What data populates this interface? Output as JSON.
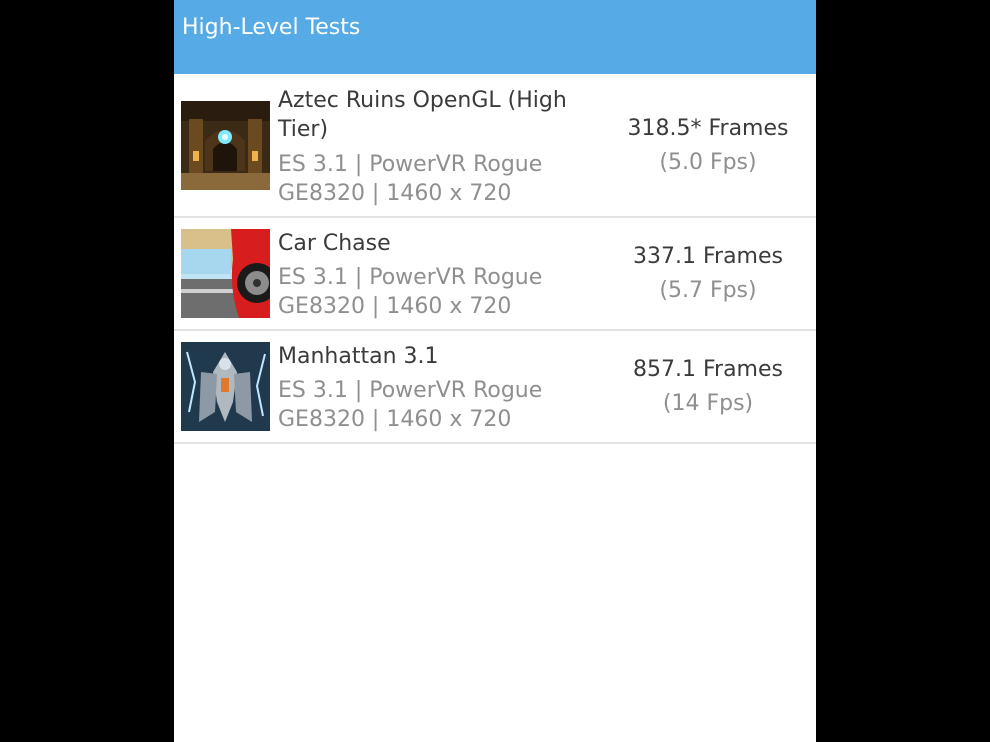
{
  "header": {
    "title": "High-Level Tests",
    "color": "#56abe6"
  },
  "tests": [
    {
      "title": "Aztec Ruins OpenGL (High Tier)",
      "api_line": "ES 3.1 | PowerVR Rogue",
      "device_line": "GE8320 | 1460 x 720",
      "frames": "318.5* Frames",
      "fps": "(5.0 Fps)",
      "thumbnail": "aztec-ruins-thumbnail"
    },
    {
      "title": "Car Chase",
      "api_line": "ES 3.1 | PowerVR Rogue",
      "device_line": "GE8320 | 1460 x 720",
      "frames": "337.1 Frames",
      "fps": "(5.7 Fps)",
      "thumbnail": "car-chase-thumbnail"
    },
    {
      "title": "Manhattan 3.1",
      "api_line": "ES 3.1 | PowerVR Rogue",
      "device_line": "GE8320 | 1460 x 720",
      "frames": "857.1 Frames",
      "fps": "(14 Fps)",
      "thumbnail": "manhattan-thumbnail"
    }
  ]
}
